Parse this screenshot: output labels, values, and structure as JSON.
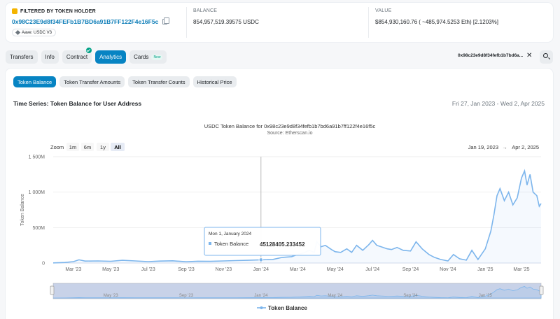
{
  "header": {
    "holder_label": "FILTERED BY TOKEN HOLDER",
    "holder_address": "0x98C23E9d8f34FEFb1B7BD6a91B7FF122F4e16F5c",
    "holder_tag": "Aave: USDC V3",
    "balance_label": "BALANCE",
    "balance_value": "854,957,519.39575 USDC",
    "value_label": "VALUE",
    "value_value": "$854,930,160.76 ( ~485,974.5253 Eth) [2.1203%]"
  },
  "tabs": [
    {
      "label": "Transfers"
    },
    {
      "label": "Info"
    },
    {
      "label": "Contract"
    },
    {
      "label": "Analytics"
    },
    {
      "label": "Cards",
      "badge": "New"
    }
  ],
  "filter_address": "0x98c23e9d8f34fefb1b7bd6a...",
  "subtabs": [
    "Token Balance",
    "Token Transfer Amounts",
    "Token Transfer Counts",
    "Historical Price"
  ],
  "timeseries": {
    "title": "Time Series: Token Balance for User Address",
    "range": "Fri 27, Jan 2023 - Wed 2, Apr 2025"
  },
  "zoom": {
    "label": "Zoom",
    "options": [
      "1m",
      "6m",
      "1y",
      "All"
    ],
    "selected": "All"
  },
  "date_range": {
    "from": "Jan 19, 2023",
    "arrow": "→",
    "to": "Apr 2, 2025"
  },
  "tooltip": {
    "date": "Mon 1, January 2024",
    "series": "Token Balance",
    "value": "45128405.233452"
  },
  "colors": {
    "accent": "#0784c3",
    "line": "#7cb5ec",
    "link": "#0b7cb7"
  },
  "chart_data": {
    "type": "line",
    "title": "USDC Token Balance for 0x98c23e9d8f34fefb1b7bd6a91b7ff122f4e16f5c",
    "subtitle": "Source: Etherscan.io",
    "ylabel": "Token Balance",
    "xlabel": "",
    "ylim": [
      0,
      1500000000
    ],
    "y_ticks": [
      {
        "v": 0,
        "label": "0"
      },
      {
        "v": 500000000,
        "label": "500M"
      },
      {
        "v": 1000000000,
        "label": "1 000M"
      },
      {
        "v": 1500000000,
        "label": "1 500M"
      }
    ],
    "x_ticks": [
      {
        "date": "2023-03-01",
        "label": "Mar '23"
      },
      {
        "date": "2023-05-01",
        "label": "May '23"
      },
      {
        "date": "2023-07-01",
        "label": "Jul '23"
      },
      {
        "date": "2023-09-01",
        "label": "Sep '23"
      },
      {
        "date": "2023-11-01",
        "label": "Nov '23"
      },
      {
        "date": "2024-01-01",
        "label": "Jan '24"
      },
      {
        "date": "2024-03-01",
        "label": "Mar '24"
      },
      {
        "date": "2024-05-01",
        "label": "May '24"
      },
      {
        "date": "2024-07-01",
        "label": "Jul '24"
      },
      {
        "date": "2024-09-01",
        "label": "Sep '24"
      },
      {
        "date": "2024-11-01",
        "label": "Nov '24"
      },
      {
        "date": "2025-01-01",
        "label": "Jan '25"
      },
      {
        "date": "2025-03-01",
        "label": "Mar '25"
      }
    ],
    "navigator_labels": [
      {
        "date": "2023-05-01",
        "label": "May '23"
      },
      {
        "date": "2023-09-01",
        "label": "Sep '23"
      },
      {
        "date": "2024-01-01",
        "label": "Jan '24"
      },
      {
        "date": "2024-05-01",
        "label": "May '24"
      },
      {
        "date": "2024-09-01",
        "label": "Sep '24"
      },
      {
        "date": "2025-01-01",
        "label": "Jan '25"
      }
    ],
    "series": [
      {
        "name": "Token Balance",
        "points": [
          [
            "2023-01-27",
            2000000
          ],
          [
            "2023-02-15",
            8000000
          ],
          [
            "2023-03-01",
            20000000
          ],
          [
            "2023-03-10",
            45000000
          ],
          [
            "2023-03-20",
            28000000
          ],
          [
            "2023-04-10",
            30000000
          ],
          [
            "2023-05-01",
            25000000
          ],
          [
            "2023-05-20",
            38000000
          ],
          [
            "2023-06-10",
            30000000
          ],
          [
            "2023-07-01",
            20000000
          ],
          [
            "2023-07-20",
            28000000
          ],
          [
            "2023-08-10",
            32000000
          ],
          [
            "2023-09-01",
            18000000
          ],
          [
            "2023-09-20",
            26000000
          ],
          [
            "2023-10-10",
            24000000
          ],
          [
            "2023-11-01",
            30000000
          ],
          [
            "2023-11-20",
            35000000
          ],
          [
            "2023-12-10",
            38000000
          ],
          [
            "2024-01-01",
            45128405
          ],
          [
            "2024-01-20",
            50000000
          ],
          [
            "2024-02-05",
            80000000
          ],
          [
            "2024-02-20",
            90000000
          ],
          [
            "2024-03-01",
            120000000
          ],
          [
            "2024-03-10",
            140000000
          ],
          [
            "2024-03-20",
            180000000
          ],
          [
            "2024-03-28",
            150000000
          ],
          [
            "2024-04-01",
            300000000
          ],
          [
            "2024-04-08",
            230000000
          ],
          [
            "2024-04-15",
            250000000
          ],
          [
            "2024-04-25",
            190000000
          ],
          [
            "2024-05-01",
            160000000
          ],
          [
            "2024-05-10",
            150000000
          ],
          [
            "2024-05-20",
            200000000
          ],
          [
            "2024-05-28",
            150000000
          ],
          [
            "2024-06-05",
            250000000
          ],
          [
            "2024-06-15",
            180000000
          ],
          [
            "2024-06-25",
            260000000
          ],
          [
            "2024-07-01",
            320000000
          ],
          [
            "2024-07-08",
            250000000
          ],
          [
            "2024-07-15",
            230000000
          ],
          [
            "2024-07-25",
            200000000
          ],
          [
            "2024-08-01",
            190000000
          ],
          [
            "2024-08-10",
            220000000
          ],
          [
            "2024-08-20",
            180000000
          ],
          [
            "2024-09-01",
            170000000
          ],
          [
            "2024-09-10",
            300000000
          ],
          [
            "2024-09-20",
            200000000
          ],
          [
            "2024-10-01",
            120000000
          ],
          [
            "2024-10-10",
            80000000
          ],
          [
            "2024-10-20",
            50000000
          ],
          [
            "2024-11-01",
            30000000
          ],
          [
            "2024-11-10",
            120000000
          ],
          [
            "2024-11-20",
            60000000
          ],
          [
            "2024-12-01",
            40000000
          ],
          [
            "2024-12-10",
            180000000
          ],
          [
            "2024-12-20",
            50000000
          ],
          [
            "2025-01-01",
            200000000
          ],
          [
            "2025-01-10",
            450000000
          ],
          [
            "2025-01-15",
            680000000
          ],
          [
            "2025-01-20",
            950000000
          ],
          [
            "2025-01-25",
            1050000000
          ],
          [
            "2025-02-01",
            880000000
          ],
          [
            "2025-02-08",
            1000000000
          ],
          [
            "2025-02-15",
            820000000
          ],
          [
            "2025-02-22",
            920000000
          ],
          [
            "2025-03-01",
            1200000000
          ],
          [
            "2025-03-06",
            1300000000
          ],
          [
            "2025-03-10",
            1100000000
          ],
          [
            "2025-03-15",
            1250000000
          ],
          [
            "2025-03-20",
            1000000000
          ],
          [
            "2025-03-26",
            950000000
          ],
          [
            "2025-03-30",
            800000000
          ],
          [
            "2025-04-02",
            840000000
          ]
        ]
      }
    ],
    "legend": {
      "position": "bottom"
    },
    "grid": true
  }
}
